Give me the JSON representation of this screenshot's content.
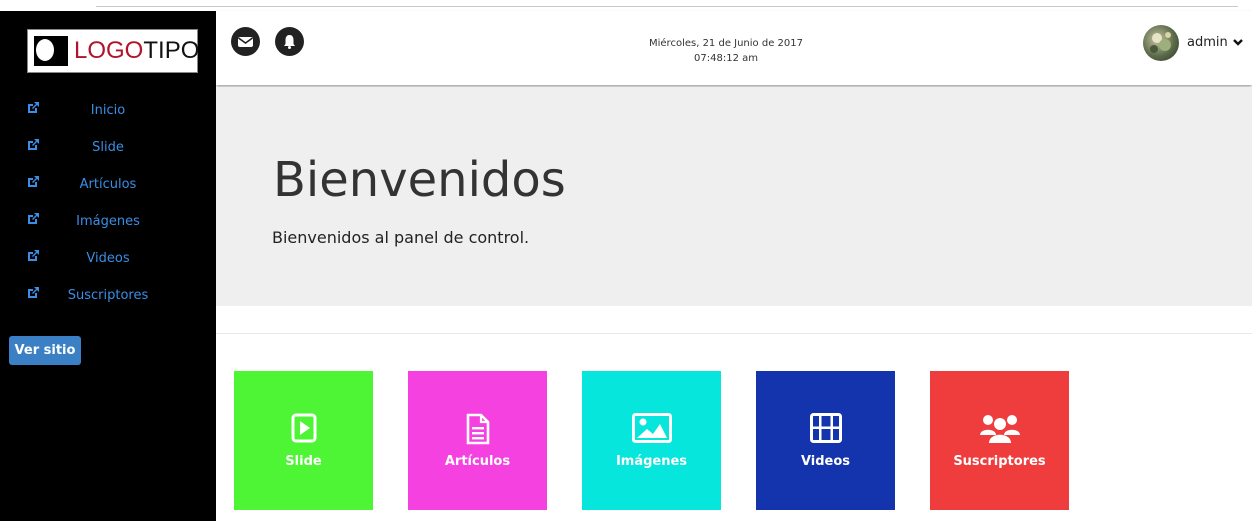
{
  "logo": {
    "part1": "LOGO",
    "part2": "TIPO"
  },
  "sidebar": {
    "items": [
      {
        "label": "Inicio"
      },
      {
        "label": "Slide"
      },
      {
        "label": "Artículos"
      },
      {
        "label": "Imágenes"
      },
      {
        "label": "Videos"
      },
      {
        "label": "Suscriptores"
      }
    ],
    "ver_sitio": "Ver sitio"
  },
  "header": {
    "date": "Miércoles, 21 de Junio de 2017",
    "time": "07:48:12 am",
    "user": "admin",
    "icons": [
      "envelope-icon",
      "bell-icon",
      "chevron-down-icon"
    ]
  },
  "hero": {
    "title": "Bienvenidos",
    "subtitle": "Bienvenidos al panel de control."
  },
  "tiles": [
    {
      "label": "Slide",
      "color": "#4ef535",
      "icon": "play-icon"
    },
    {
      "label": "Artículos",
      "color": "#f541e0",
      "icon": "document-icon"
    },
    {
      "label": "Imágenes",
      "color": "#06e6dc",
      "icon": "image-icon"
    },
    {
      "label": "Videos",
      "color": "#1334ad",
      "icon": "film-icon"
    },
    {
      "label": "Suscriptores",
      "color": "#ef3c3c",
      "icon": "users-icon"
    }
  ],
  "colors": {
    "sidebar_bg": "#000000",
    "nav_link": "#3a8ee6",
    "button": "#3b80c4",
    "hero_bg": "#efefef"
  }
}
